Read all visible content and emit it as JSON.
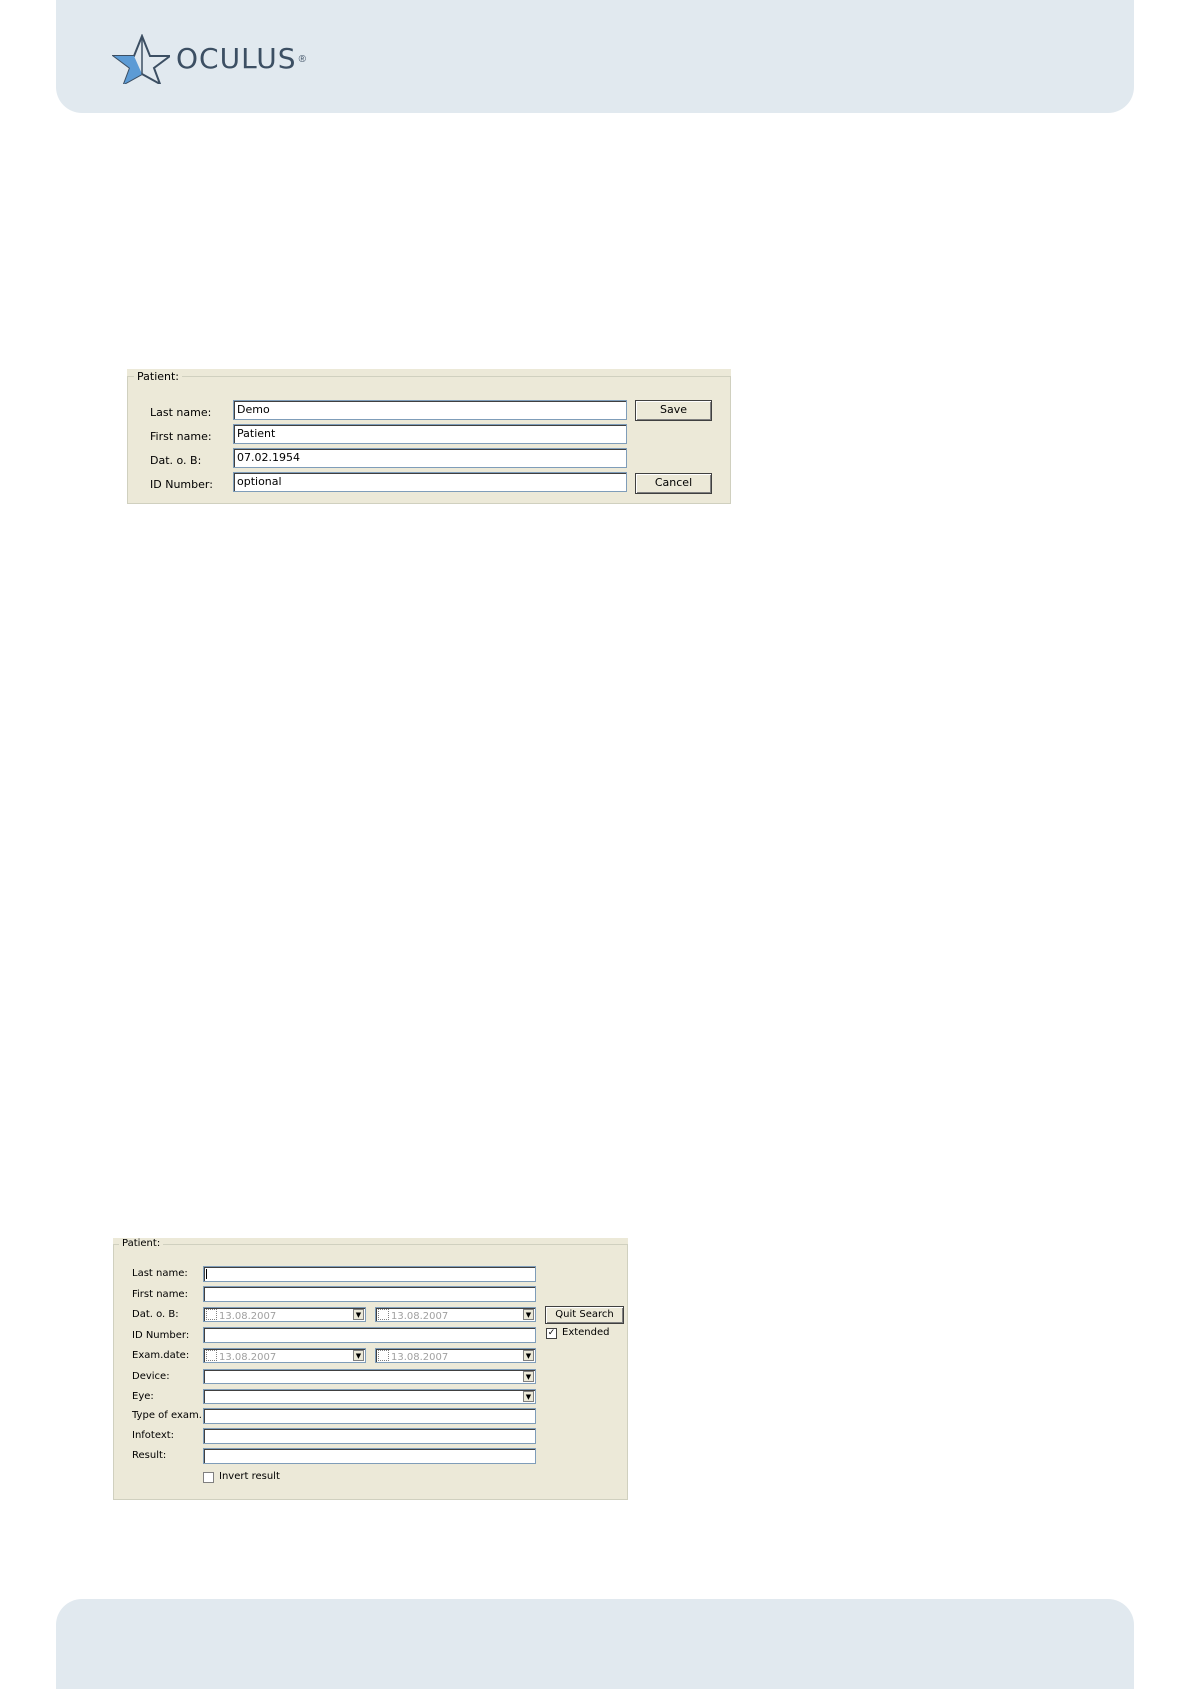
{
  "header": {
    "logo_text": "OCULUS",
    "logo_mark": "®",
    "brand_color": "#5c9bd5"
  },
  "dialog1": {
    "group_title": "Patient:",
    "labels": {
      "last_name": "Last name:",
      "first_name": "First name:",
      "dob": "Dat. o. B:",
      "id_number": "ID Number:"
    },
    "values": {
      "last_name": "Demo",
      "first_name": "Patient",
      "dob": "07.02.1954",
      "id_number": "optional"
    },
    "save_label": "Save",
    "cancel_label": "Cancel"
  },
  "dialog2": {
    "group_title": "Patient:",
    "labels": {
      "last_name": "Last name:",
      "first_name": "First name:",
      "dob": "Dat. o. B:",
      "id_number": "ID Number:",
      "exam_date": "Exam.date:",
      "device": "Device:",
      "eye": "Eye:",
      "type_of_exam": "Type of exam.:",
      "infotext": "Infotext:",
      "result": "Result:"
    },
    "dob_from": "13.08.2007",
    "dob_to": "13.08.2007",
    "exam_from": "13.08.2007",
    "exam_to": "13.08.2007",
    "quit_search_label": "Quit Search",
    "extended_label": "Extended",
    "extended_checked": true,
    "invert_result_label": "Invert result",
    "invert_result_checked": false
  }
}
